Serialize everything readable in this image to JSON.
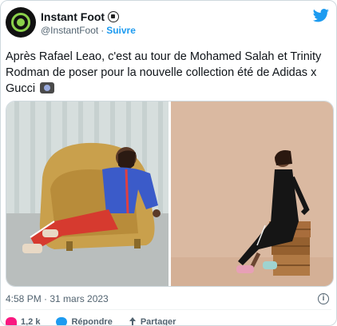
{
  "author": {
    "display_name": "Instant Foot",
    "handle": "@InstantFoot",
    "separator": "·",
    "follow_label": "Suivre"
  },
  "tweet": {
    "text": "Après Rafael Leao, c'est au tour de Mohamed Salah et Trinity Rodman de poser pour la nouvelle collection été de Adidas x Gucci"
  },
  "meta": {
    "timestamp": "4:58 PM · 31 mars 2023",
    "info_label": "i"
  },
  "actions": {
    "like_count": "1,2 k",
    "reply_label": "Répondre",
    "share_label": "Partager"
  },
  "colors": {
    "brand_blue": "#1d9bf0",
    "like_pink": "#f91880",
    "text_primary": "#0f1419",
    "text_secondary": "#536471",
    "avatar_green": "#8bd14a"
  },
  "icons": {
    "verified_emoji": "soccer-ball-icon",
    "text_emoji": "camera-flash-icon",
    "platform": "twitter-bird-icon"
  }
}
